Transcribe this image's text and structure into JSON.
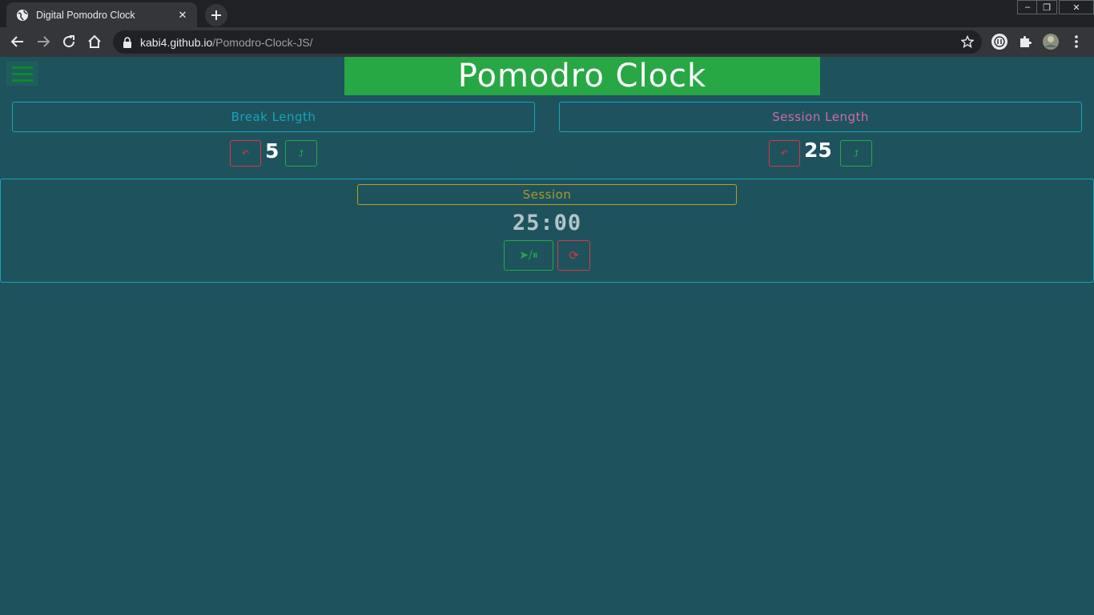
{
  "browser": {
    "tab_title": "Digital Pomodro Clock",
    "tab_close": "✕",
    "new_tab": "+",
    "url_host": "kabi4.github.io",
    "url_path": "/Pomodro-Clock-JS/",
    "window_minimize": "–",
    "window_restore": "❐",
    "window_close": "✕"
  },
  "page": {
    "title": "Pomodro Clock",
    "break": {
      "label": "Break Length",
      "value": "5",
      "decrement_label": "↶",
      "increment_label": "⮥"
    },
    "session": {
      "label": "Session Length",
      "value": "25",
      "decrement_label": "↶",
      "increment_label": "⮥"
    },
    "timer": {
      "label": "Session",
      "time_left": "25:00",
      "start_stop_label": "➤/⏸",
      "reset_label": "⟳"
    }
  },
  "colors": {
    "background": "#1e535e",
    "title_bg": "#28a745",
    "info": "#17a2b8",
    "danger": "#dc3545",
    "success": "#28a745",
    "session_pink": "#d06aa1",
    "session_gold": "#b8a01f"
  }
}
